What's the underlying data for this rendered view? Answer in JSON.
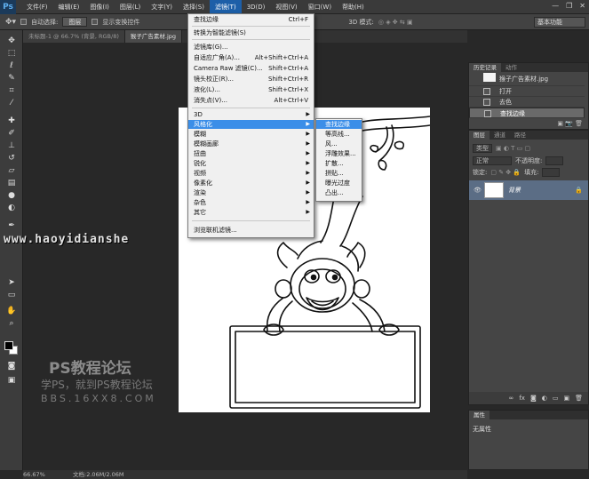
{
  "app": {
    "logo": "Ps",
    "menu": [
      "文件(F)",
      "编辑(E)",
      "图像(I)",
      "图层(L)",
      "文字(Y)",
      "选择(S)",
      "滤镜(T)",
      "3D(D)",
      "视图(V)",
      "窗口(W)",
      "帮助(H)"
    ],
    "active_menu_index": 6,
    "window_controls": [
      "—",
      "❐",
      "✕"
    ]
  },
  "options_bar": {
    "auto_select_label": "自动选择:",
    "auto_select_value": "图层",
    "show_transform_label": "显示变换控件",
    "mode_3d_label": "3D 模式:",
    "workspace": "基本功能"
  },
  "tabs": [
    {
      "label": "未标题-1 @ 66.7% (背景, RGB/8)",
      "active": false
    },
    {
      "label": "猴子广告素材.jpg",
      "active": true
    }
  ],
  "filter_menu": {
    "items": [
      {
        "label": "查找边缘",
        "shortcut": "Ctrl+F"
      },
      {
        "label": "转换为智能滤镜(S)",
        "shortcut": ""
      },
      {
        "label": "滤镜库(G)...",
        "shortcut": ""
      },
      {
        "label": "自适应广角(A)...",
        "shortcut": "Alt+Shift+Ctrl+A"
      },
      {
        "label": "Camera Raw 滤镜(C)...",
        "shortcut": "Shift+Ctrl+A"
      },
      {
        "label": "镜头校正(R)...",
        "shortcut": "Shift+Ctrl+R"
      },
      {
        "label": "液化(L)...",
        "shortcut": "Shift+Ctrl+X"
      },
      {
        "label": "消失点(V)...",
        "shortcut": "Alt+Ctrl+V"
      },
      {
        "label": "3D",
        "shortcut": ""
      },
      {
        "label": "风格化",
        "shortcut": ""
      },
      {
        "label": "模糊",
        "shortcut": ""
      },
      {
        "label": "模糊画廊",
        "shortcut": ""
      },
      {
        "label": "扭曲",
        "shortcut": ""
      },
      {
        "label": "锐化",
        "shortcut": ""
      },
      {
        "label": "视频",
        "shortcut": ""
      },
      {
        "label": "像素化",
        "shortcut": ""
      },
      {
        "label": "渲染",
        "shortcut": ""
      },
      {
        "label": "杂色",
        "shortcut": ""
      },
      {
        "label": "其它",
        "shortcut": ""
      },
      {
        "label": "浏览联机滤镜...",
        "shortcut": ""
      }
    ],
    "highlighted_index": 9
  },
  "stylize_submenu": {
    "items": [
      "查找边缘",
      "等高线...",
      "风...",
      "浮雕效果...",
      "扩散...",
      "拼贴...",
      "曝光过度",
      "凸出..."
    ],
    "highlighted_index": 0
  },
  "history_panel": {
    "tabs": [
      "历史记录",
      "动作"
    ],
    "snapshot_label": "猴子广告素材.jpg",
    "steps": [
      "打开",
      "去色",
      "查找边缘"
    ],
    "selected_index": 2
  },
  "layers_panel": {
    "tabs": [
      "图层",
      "通道",
      "路径"
    ],
    "kind_label": "类型",
    "blend_mode": "正常",
    "opacity_label": "不透明度:",
    "lock_label": "锁定:",
    "fill_label": "填充:",
    "layer_name": "背景"
  },
  "properties_panel": {
    "title": "属性",
    "content": "无属性"
  },
  "status_bar": {
    "zoom": "66.67%",
    "doc_info": "文档:2.06M/2.06M"
  },
  "watermark": {
    "url": "www.haoyidianshe",
    "title": "PS教程论坛",
    "subtitle": "学PS，就到PS教程论坛",
    "bbs": "BBS.16XX8.COM"
  },
  "icons": {
    "toolbar": [
      "move-icon",
      "marquee-icon",
      "lasso-icon",
      "quick-select-icon",
      "crop-icon",
      "eyedropper-icon",
      "healing-icon",
      "brush-icon",
      "stamp-icon",
      "history-brush-icon",
      "eraser-icon",
      "gradient-icon",
      "blur-icon",
      "dodge-icon",
      "pen-icon",
      "type-icon",
      "path-select-icon",
      "shape-icon",
      "hand-icon",
      "zoom-icon"
    ]
  }
}
